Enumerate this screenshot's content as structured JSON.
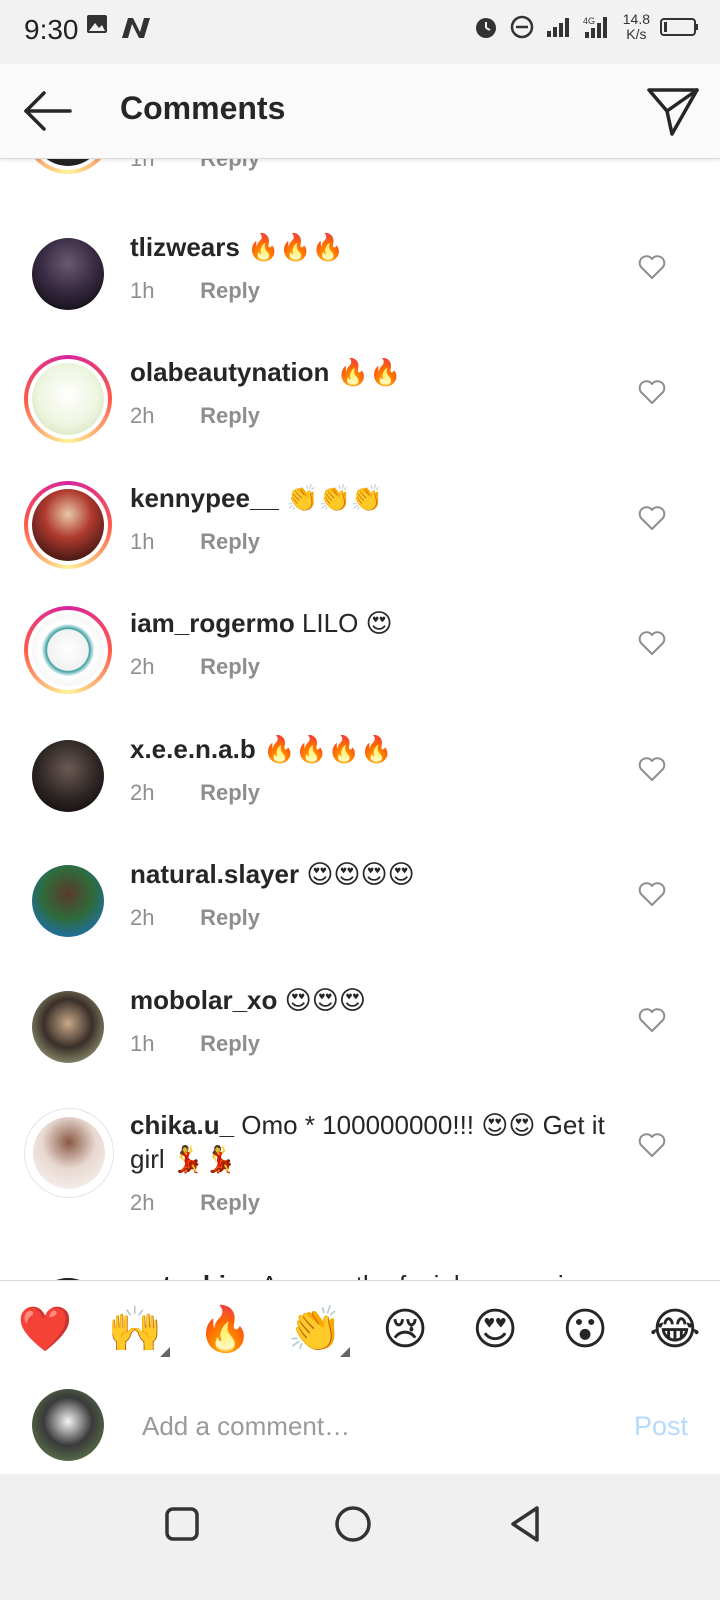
{
  "status_bar": {
    "time": "9:30",
    "net_speed_value": "14.8",
    "net_speed_unit": "K/s",
    "icons": [
      "gallery-icon",
      "n-notification-icon",
      "alarm-icon",
      "do-not-disturb-icon",
      "signal-icon",
      "signal-4g-icon",
      "battery-icon"
    ]
  },
  "header": {
    "title": "Comments",
    "back_icon": "arrow-left-icon",
    "send_icon": "paper-plane-icon"
  },
  "comments": [
    {
      "username": "",
      "text": "",
      "time": "1h",
      "reply": "Reply",
      "partial": true
    },
    {
      "username": "tlizwears",
      "text": "🔥🔥🔥",
      "time": "1h",
      "reply": "Reply"
    },
    {
      "username": "olabeautynation",
      "text": "🔥🔥",
      "time": "2h",
      "reply": "Reply"
    },
    {
      "username": "kennypee__",
      "text": "👏👏👏",
      "time": "1h",
      "reply": "Reply"
    },
    {
      "username": "iam_rogermo",
      "text": "LILO 😍",
      "time": "2h",
      "reply": "Reply"
    },
    {
      "username": "x.e.e.n.a.b",
      "text": "🔥🔥🔥🔥",
      "time": "2h",
      "reply": "Reply"
    },
    {
      "username": "natural.slayer",
      "text": "😍😍😍😍",
      "time": "2h",
      "reply": "Reply"
    },
    {
      "username": "mobolar_xo",
      "text": "😍😍😍",
      "time": "1h",
      "reply": "Reply"
    },
    {
      "username": "chika.u_",
      "text": "Omo * 100000000!!! 😍😍 Get it girl 💃💃",
      "time": "2h",
      "reply": "Reply"
    },
    {
      "username": "_tunbi__",
      "text": "Awwwn the facial expression",
      "time": "",
      "reply": "",
      "partial": true
    }
  ],
  "emoji_bar": [
    "❤️",
    "🙌",
    "🔥",
    "👏",
    "😢",
    "😍",
    "😮",
    "😂"
  ],
  "compose": {
    "placeholder": "Add a comment…",
    "post_label": "Post"
  },
  "colors": {
    "header_bg": "#fafafa",
    "text": "#262626",
    "meta": "#8e8e8e",
    "post_disabled": "#b3dbff",
    "ring_gradient": [
      "#d6249f",
      "#fd5949",
      "#fdf497"
    ]
  }
}
